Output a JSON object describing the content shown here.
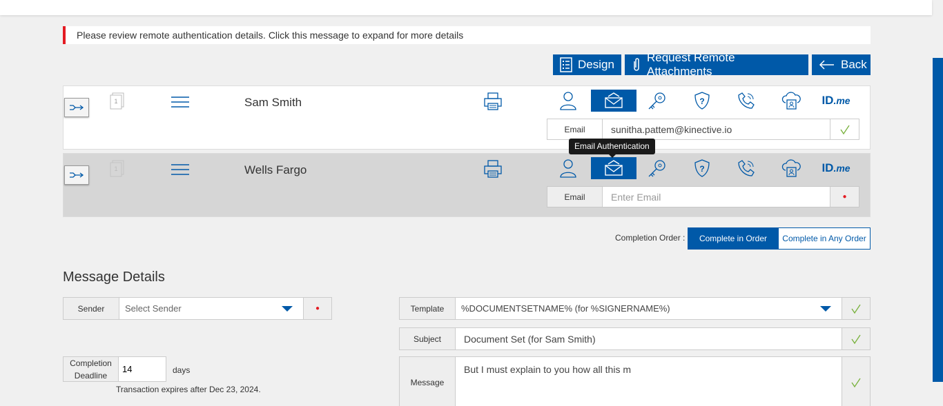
{
  "alert": {
    "message": "Please review remote authentication details. Click this message to expand for more details"
  },
  "toolbar": {
    "design_label": "Design",
    "attachments_label": "Request Remote Attachments",
    "back_label": "Back"
  },
  "signers": [
    {
      "name": "Sam Smith",
      "email_label": "Email",
      "email_value": "sunitha.pattem@kinective.io",
      "email_placeholder": "Enter Email"
    },
    {
      "name": "Wells Fargo",
      "email_label": "Email",
      "email_value": "",
      "email_placeholder": "Enter Email"
    }
  ],
  "auth_tooltip": "Email Authentication",
  "auth_icons": [
    "person-icon",
    "email-icon",
    "key-icon",
    "shield-question-icon",
    "phone-icon",
    "cloud-id-icon",
    "idme-logo"
  ],
  "idme": {
    "id": "ID",
    "me": ".me"
  },
  "completion": {
    "label": "Completion Order :",
    "in_order": "Complete in Order",
    "any_order": "Complete in Any Order"
  },
  "message_details": {
    "title": "Message Details",
    "sender_label": "Sender",
    "sender_placeholder": "Select Sender",
    "template_label": "Template",
    "template_value": "%DOCUMENTSETNAME% (for %SIGNERNAME%)",
    "subject_label": "Subject",
    "subject_value": "Document Set (for Sam Smith)",
    "message_label": "Message",
    "message_value": "But I must explain to you how all this m",
    "deadline_label_1": "Completion",
    "deadline_label_2": "Deadline",
    "deadline_value": "14",
    "deadline_unit": "days",
    "expires_text": "Transaction expires after Dec 23, 2024."
  },
  "colors": {
    "primary": "#0059a8",
    "alert": "#e31b23",
    "check": "#7cb342"
  }
}
